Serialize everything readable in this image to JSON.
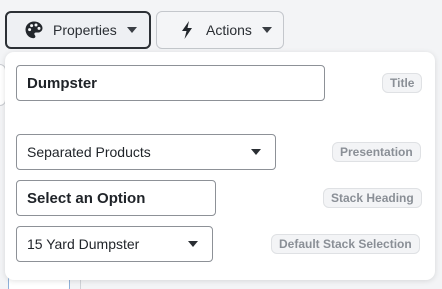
{
  "toolbar": {
    "properties": {
      "label": "Properties",
      "icon": "palette-icon"
    },
    "actions": {
      "label": "Actions",
      "icon": "lightning-bolt-icon"
    }
  },
  "panel": {
    "title_field": {
      "value": "Dumpster",
      "tag": "Title"
    },
    "presentation_field": {
      "value": "Separated Products",
      "tag": "Presentation"
    },
    "stack_heading_field": {
      "value": "Select an Option",
      "tag": "Stack Heading"
    },
    "default_stack_field": {
      "value": "15 Yard Dumpster",
      "tag": "Default Stack Selection"
    }
  }
}
